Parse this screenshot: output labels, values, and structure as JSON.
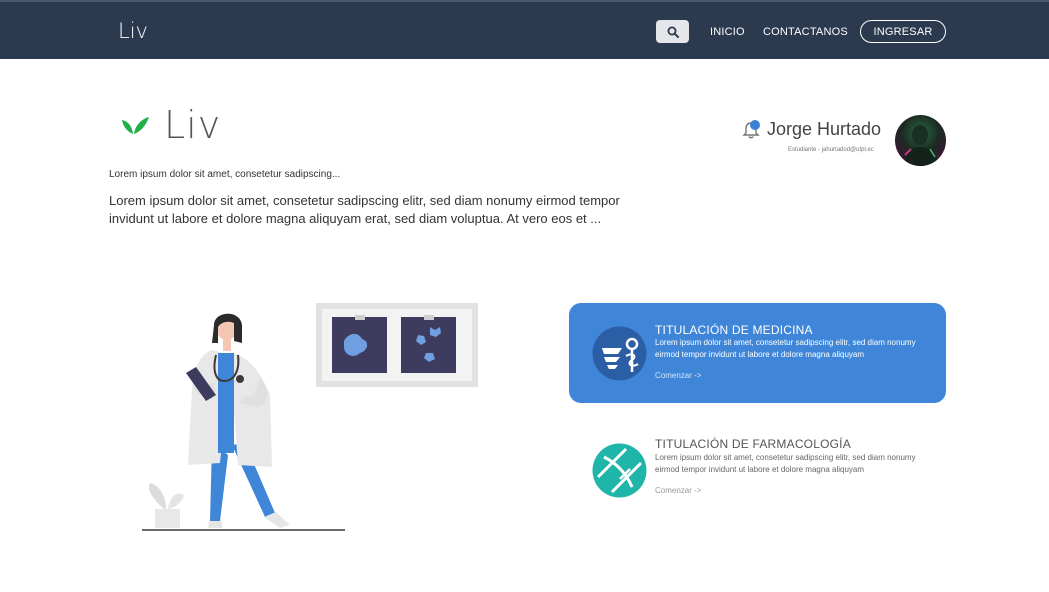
{
  "navbar": {
    "brand": "Liv",
    "search_icon": "search-icon",
    "links": [
      "INICIO",
      "CONTACTANOS"
    ],
    "login_label": "INGRESAR"
  },
  "hero": {
    "logo_text": "Liv",
    "subtitle": "Lorem ipsum dolor sit amet, consetetur sadipscing...",
    "body": "Lorem ipsum dolor sit amet, consetetur sadipscing elitr, sed diam nonumy eirmod tempor invidunt ut labore et dolore magna aliquyam erat, sed diam voluptua. At vero eos et ..."
  },
  "user": {
    "name": "Jorge Hurtado",
    "subtitle": "Estudiante - jahurtadod@utpl.ec",
    "notification_icon": "bell-icon"
  },
  "cards": [
    {
      "title": "TITULACIÓN DE MEDICINA",
      "description": "Lorem ipsum dolor sit amet, consetetur sadipscing elitr, sed diam nonumy eirmod tempor invidunt ut labore et dolore magna aliquyam",
      "link": "Comenzar ->",
      "icon": "medicine-caduceus-icon",
      "color": "#3f86d8"
    },
    {
      "title": "TITULACIÓN DE FARMACOLOGÍA",
      "description": "Lorem ipsum dolor sit amet, consetetur sadipscing elitr, sed diam nonumy eirmod tempor invidunt ut labore et dolore magna aliquyam",
      "link": "Comenzar ->",
      "icon": "pharmacy-pill-icon",
      "color": "#1fb5a8"
    }
  ],
  "colors": {
    "navbar": "#2b3a4e",
    "accent_blue": "#3f86d8",
    "accent_teal": "#1fb5a8",
    "logo_green": "#22b04a"
  }
}
